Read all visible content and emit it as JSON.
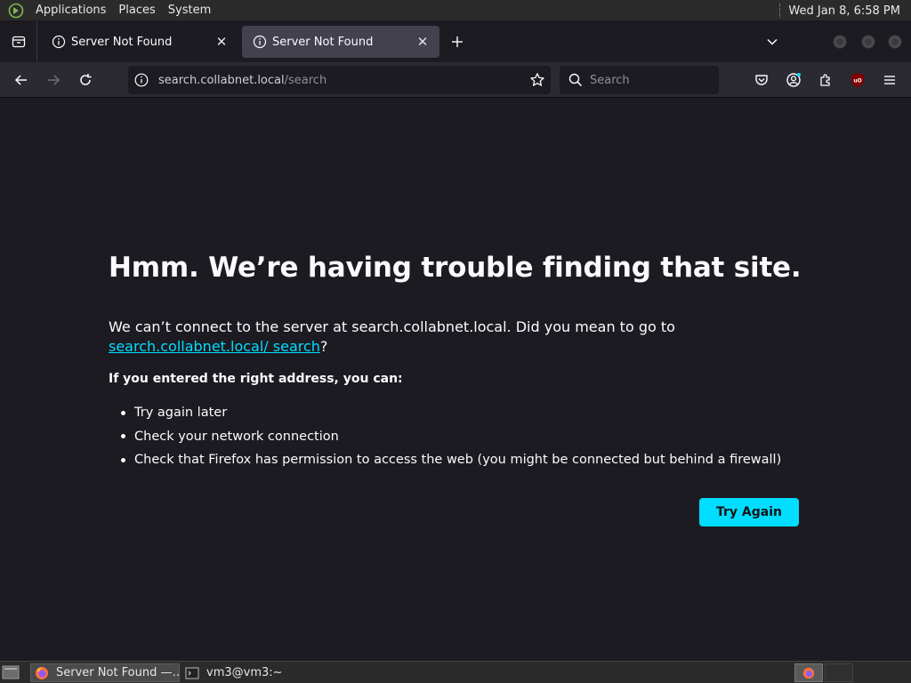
{
  "top_panel": {
    "menus": [
      "Applications",
      "Places",
      "System"
    ],
    "clock": "Wed Jan  8,  6:58 PM"
  },
  "tabs": [
    {
      "title": "Server Not Found",
      "active": false
    },
    {
      "title": "Server Not Found",
      "active": true
    }
  ],
  "navbar": {
    "url_host": "search.collabnet.local",
    "url_path": "/search",
    "search_placeholder": "Search"
  },
  "error_page": {
    "title": "Hmm. We’re having trouble finding that site.",
    "desc_before": "We can’t connect to the server at search.collabnet.local. Did you mean to go to ",
    "desc_link": "search.collabnet.local/ search",
    "desc_after": "?",
    "subheading": "If you entered the right address, you can:",
    "suggestions": [
      "Try again later",
      "Check your network connection",
      "Check that Firefox has permission to access the web (you might be connected but behind a firewall)"
    ],
    "button_label": "Try Again"
  },
  "taskbar": {
    "tasks": [
      {
        "title": "Server Not Found —…",
        "active": true
      },
      {
        "title": "vm3@vm3:~",
        "active": false
      }
    ]
  },
  "colors": {
    "accent": "#00ddff",
    "page_bg": "#1c1b22",
    "toolbar_bg": "#2b2a33"
  }
}
